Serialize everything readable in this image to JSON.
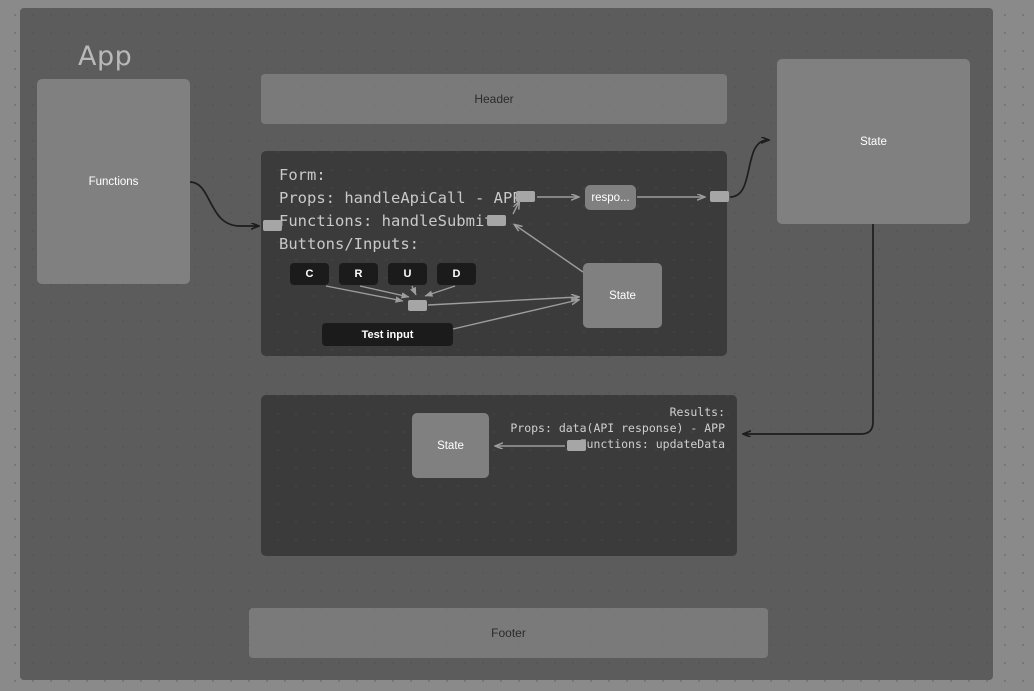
{
  "canvas": {
    "background_color": "#8a8a8a",
    "dot_grid": true
  },
  "app_group": {
    "title": "App",
    "background_color": "#5c5c5c"
  },
  "nodes": {
    "functions": {
      "label": "Functions",
      "color": "#808080"
    },
    "header": {
      "label": "Header"
    },
    "footer": {
      "label": "Footer"
    },
    "response": {
      "label": "respo..."
    },
    "state_outer": {
      "label": "State"
    },
    "state_form": {
      "label": "State"
    },
    "state_results": {
      "label": "State"
    },
    "test_input": {
      "label": "Test input"
    }
  },
  "form_panel": {
    "lines": [
      "Form:",
      "Props: handleApiCall - APP",
      "Functions: handleSubmit",
      "Buttons/Inputs:"
    ],
    "crud_buttons": [
      {
        "label": "C"
      },
      {
        "label": "R"
      },
      {
        "label": "U"
      },
      {
        "label": "D"
      }
    ]
  },
  "results_panel": {
    "lines": [
      "Results:",
      "Props: data(API response) - APP",
      "Functions: updateData"
    ]
  }
}
